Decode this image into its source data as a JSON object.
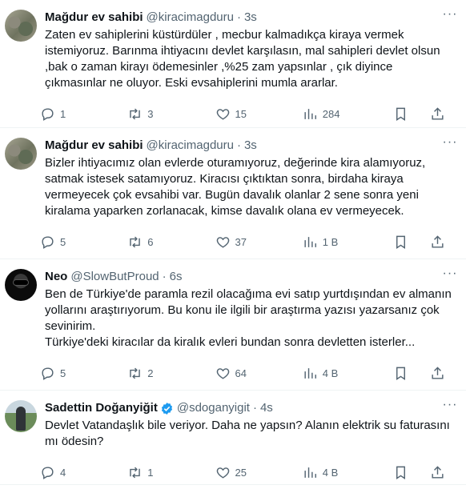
{
  "tweets": [
    {
      "name": "Mağdur ev sahibi",
      "handle": "@kiracimagduru",
      "sep": "·",
      "time": "3s",
      "text": "Zaten ev sahiplerini küstürdüler , mecbur kalmadıkça kiraya vermek istemiyoruz. Barınma ihtiyacını devlet karşılasın, mal sahipleri devlet olsun ,bak o zaman kirayı ödemesinler ,%25 zam yapsınlar , çık diyince çıkmasınlar ne oluyor. Eski evsahiplerini mumla ararlar.",
      "replies": "1",
      "reposts": "3",
      "likes": "15",
      "views": "284"
    },
    {
      "name": "Mağdur ev sahibi",
      "handle": "@kiracimagduru",
      "sep": "·",
      "time": "3s",
      "text": "Bizler ihtiyacımız olan evlerde oturamıyoruz, değerinde kira alamıyoruz, satmak istesek satamıyoruz. Kiracısı çıktıktan sonra, birdaha kiraya vermeyecek çok evsahibi var. Bugün davalık olanlar 2 sene sonra yeni kiralama yaparken zorlanacak, kimse davalık olana ev vermeyecek.",
      "replies": "5",
      "reposts": "6",
      "likes": "37",
      "views": "1 B"
    },
    {
      "name": "Neo",
      "handle": "@SlowButProud",
      "sep": "·",
      "time": "6s",
      "text": "Ben de Türkiye'de paramla rezil olacağıma evi satıp yurtdışından ev almanın yollarını araştırıyorum. Bu konu ile ilgili bir araştırma yazısı yazarsanız çok sevinirim.\nTürkiye'deki kiracılar da kiralık evleri bundan sonra devletten isterler...",
      "replies": "5",
      "reposts": "2",
      "likes": "64",
      "views": "4 B"
    },
    {
      "name": "Sadettin Doğanyiğit",
      "handle": "@sdoganyigit",
      "sep": "·",
      "time": "4s",
      "text": "Devlet Vatandaşlık bile veriyor. Daha ne yapsın? Alanın elektrik su faturasını mı ödesin?",
      "replies": "4",
      "reposts": "1",
      "likes": "25",
      "views": "4 B"
    }
  ],
  "icons": {
    "more": "more-icon",
    "reply": "reply-icon",
    "repost": "repost-icon",
    "like": "like-icon",
    "views": "views-icon",
    "bookmark": "bookmark-icon",
    "share": "share-icon",
    "verified": "verified-badge-icon"
  },
  "colors": {
    "text": "#0f1419",
    "muted": "#536471",
    "verified": "#1d9bf0",
    "divider": "#eff3f4"
  }
}
